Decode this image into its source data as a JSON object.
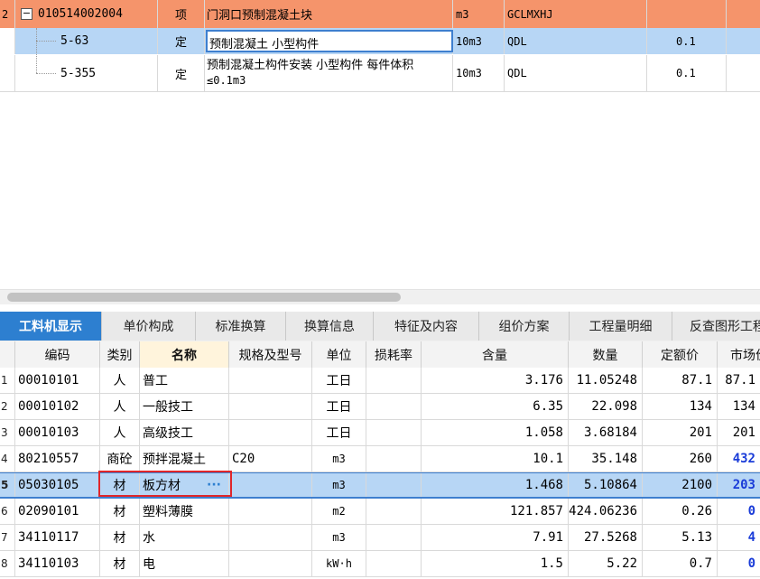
{
  "top_table": {
    "rows": [
      {
        "index": "2",
        "code": "010514002004",
        "type": "项",
        "name": "门洞口预制混凝土块",
        "unit": "m3",
        "expr": "GCLMXHJ",
        "qty": ""
      },
      {
        "index": "",
        "code": "5-63",
        "type": "定",
        "name": "预制混凝土 小型构件",
        "unit": "10m3",
        "expr": "QDL",
        "qty": "0.1"
      },
      {
        "index": "",
        "code": "5-355",
        "type": "定",
        "name_line1": "预制混凝土构件安装 小型构件 每件体积",
        "name_line2": "≤0.1m3",
        "unit": "10m3",
        "expr": "QDL",
        "qty": "0.1"
      }
    ]
  },
  "tabs": [
    "工料机显示",
    "单价构成",
    "标准换算",
    "换算信息",
    "特征及内容",
    "组价方案",
    "工程量明细",
    "反查图形工程量"
  ],
  "active_tab": 0,
  "grid": {
    "headers": [
      "编码",
      "类别",
      "名称",
      "规格及型号",
      "单位",
      "损耗率",
      "含量",
      "数量",
      "定额价",
      "市场价"
    ],
    "rows": [
      {
        "n": "1",
        "code": "00010101",
        "cat": "人",
        "name": "普工",
        "spec": "",
        "unit": "工日",
        "loss": "",
        "content": "3.176",
        "qty": "11.05248",
        "price": "87.1",
        "market": "87.1"
      },
      {
        "n": "2",
        "code": "00010102",
        "cat": "人",
        "name": "一般技工",
        "spec": "",
        "unit": "工日",
        "loss": "",
        "content": "6.35",
        "qty": "22.098",
        "price": "134",
        "market": "134"
      },
      {
        "n": "3",
        "code": "00010103",
        "cat": "人",
        "name": "高级技工",
        "spec": "",
        "unit": "工日",
        "loss": "",
        "content": "1.058",
        "qty": "3.68184",
        "price": "201",
        "market": "201"
      },
      {
        "n": "4",
        "code": "80210557",
        "cat": "商砼",
        "name": "预拌混凝土",
        "spec": "C20",
        "unit": "m3",
        "loss": "",
        "content": "10.1",
        "qty": "35.148",
        "price": "260",
        "market": "432"
      },
      {
        "n": "5",
        "code": "05030105",
        "cat": "材",
        "name": "板方材",
        "spec": "",
        "unit": "m3",
        "loss": "",
        "content": "1.468",
        "qty": "5.10864",
        "price": "2100",
        "market": "203"
      },
      {
        "n": "6",
        "code": "02090101",
        "cat": "材",
        "name": "塑料薄膜",
        "spec": "",
        "unit": "m2",
        "loss": "",
        "content": "121.857",
        "qty": "424.06236",
        "price": "0.26",
        "market": "0"
      },
      {
        "n": "7",
        "code": "34110117",
        "cat": "材",
        "name": "水",
        "spec": "",
        "unit": "m3",
        "loss": "",
        "content": "7.91",
        "qty": "27.5268",
        "price": "5.13",
        "market": "4"
      },
      {
        "n": "8",
        "code": "34110103",
        "cat": "材",
        "name": "电",
        "spec": "",
        "unit": "kW·h",
        "loss": "",
        "content": "1.5",
        "qty": "5.22",
        "price": "0.7",
        "market": "0"
      }
    ],
    "ellipsis": "···"
  },
  "colors": {
    "header_row": "#f5946b",
    "selected_row": "#b7d6f5",
    "active_tab": "#2d7fd0",
    "highlight_box": "#e0262a",
    "market_price": "#1a3cd8"
  }
}
